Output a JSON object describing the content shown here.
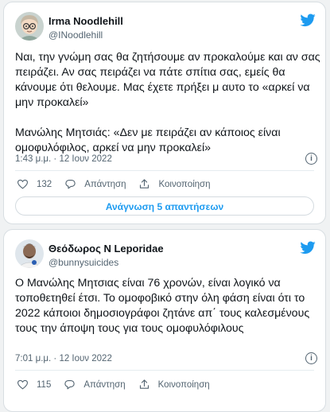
{
  "colors": {
    "link_blue": "#1d9bf0",
    "heart_red": "#f91880",
    "twitter_blue": "#1d9bf0"
  },
  "tweets": [
    {
      "name": "Irma Noodlehill",
      "handle": "@INoodlehill",
      "text": "Ναι, την γνώμη σας θα ζητήσουμε αν προκαλούμε και αν σας πειράζει. Αν σας πειράζει να πάτε σπίτια σας, εμείς θα κάνουμε ότι θελουμε. Μας έχετε πρήξει μ αυτο το «αρκεί να μην προκαλεί»\n\nΜανώλης Μητσιάς: «Δεν με πειράζει αν κάποιος είναι ομοφυλόφιλος, αρκεί να μην προκαλεί»",
      "timestamp": "1:43 μ.μ. · 12 Ιουν 2022",
      "likes": "132",
      "reply_label": "Απάντηση",
      "share_label": "Κοινοποίηση",
      "read_replies": "Ανάγνωση 5 απαντήσεων",
      "avatar_icon": "cartoon-avatar-icon"
    },
    {
      "name": "Θεόδωρος Ν Leporidae",
      "handle": "@bunnysuicides",
      "text": "Ο Μανώλης Μητσιας είναι 76 χρονών, είναι λογικό να τοποθετηθεί έτσι. Το ομοφοβικό στην όλη φάση είναι ότι το 2022 κάποιοι δημοσιογράφοι ζητάνε απ΄ τους καλεσμένους τους την άποψη τους για τους ομοφυλόφιλους",
      "timestamp": "7:01 μ.μ. · 12 Ιουν 2022",
      "likes": "115",
      "reply_label": "Απάντηση",
      "share_label": "Κοινοποίηση",
      "avatar_icon": "astronaut-avatar-icon"
    }
  ]
}
